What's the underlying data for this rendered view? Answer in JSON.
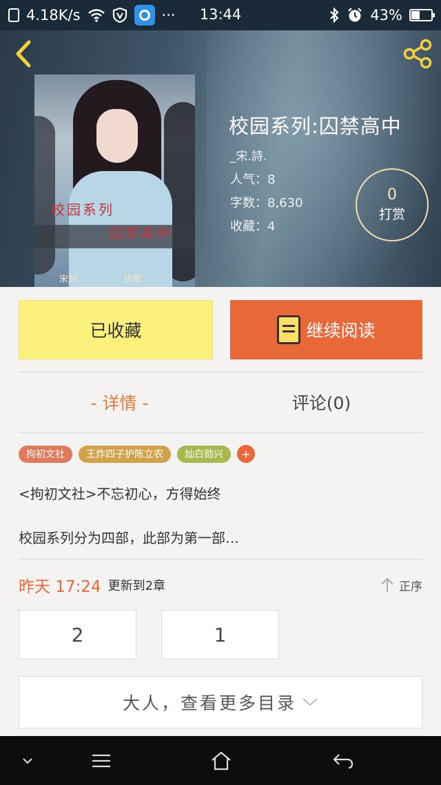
{
  "status_bar": {
    "speed": "4.18K/s",
    "time": "13:44",
    "battery_percent": "43%",
    "battery_level": 0.43,
    "more": "···"
  },
  "header": {
    "title": "校园系列:囚禁高中",
    "author": "_宋.詩.",
    "stats": {
      "popularity": "人气：8",
      "word_count": "字数：8,630",
      "favorites": "收藏：4"
    },
    "tip": {
      "count": "0",
      "label": "打赏"
    },
    "cover": {
      "title_line1": "校园系列",
      "title_line2": "囚禁高中",
      "author": "宋詩",
      "pen": "执笔"
    }
  },
  "actions": {
    "collected_label": "已收藏",
    "continue_label": "继续阅读"
  },
  "tabs": {
    "detail": "- 详情 -",
    "comments": "评论(0)"
  },
  "tags": [
    {
      "label": "拘初文社",
      "color": "#e07a5c"
    },
    {
      "label": "王炸四子护陈立农",
      "color": "#d0a24a"
    },
    {
      "label": "灿白勋兴",
      "color": "#a7b84e"
    }
  ],
  "tag_add": "+",
  "description": {
    "line1": "<拘初文社>不忘初心，方得始终",
    "line2": "校园系列分为四部，此部为第一部…"
  },
  "update": {
    "time": "昨天 17:24",
    "text": "更新到2章",
    "order_label": "正序"
  },
  "chapters": [
    "2",
    "1"
  ],
  "more_catalog": "大人，查看更多目录",
  "colors": {
    "accent": "#e8683a",
    "collected_bg": "#fbf17c",
    "page_bg": "#f4f3f1"
  }
}
